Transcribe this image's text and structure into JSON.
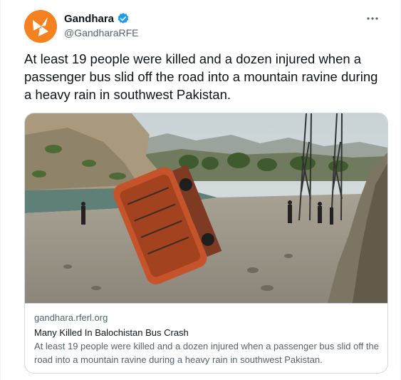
{
  "tweet": {
    "author_name": "Gandhara",
    "author_handle": "@GandharaRFE",
    "text": "At least 19 people were killed and a dozen injured when a passenger bus slid off the road into a mountain ravine during a heavy rain in southwest Pakistan.",
    "more_icon": "more-horizontal-icon",
    "verified_icon": "verified-badge-icon"
  },
  "card": {
    "domain": "gandhara.rferl.org",
    "title": "Many Killed In Balochistan Bus Crash",
    "description": "At least 19 people were killed and a dozen injured when a passenger bus slid off the road into a mountain ravine during a heavy rain in southwest Pakistan."
  },
  "colors": {
    "brand_orange": "#f58220",
    "verified_blue": "#1d9bf0",
    "text_primary": "#0f1419",
    "text_secondary": "#536471"
  }
}
